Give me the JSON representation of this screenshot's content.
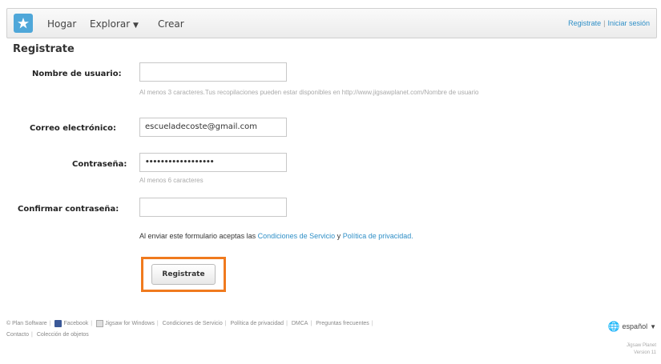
{
  "header": {
    "nav": {
      "home": "Hogar",
      "explore": "Explorar",
      "create": "Crear"
    },
    "register_link": "Registrate",
    "login_link": "Iniciar sesión"
  },
  "form": {
    "title": "Registrate",
    "username": {
      "label": "Nombre de usuario:",
      "value": "",
      "hint": "Al menos 3 caracteres.Tus recopilaciones pueden estar disponibles en http://www.jigsawplanet.com/Nombre de usuario"
    },
    "email": {
      "label": "Correo electrónico:",
      "value": "escueladecoste@gmail.com"
    },
    "password": {
      "label": "Contraseña:",
      "value": "••••••••••••••••••",
      "hint": "Al menos 6 caracteres"
    },
    "confirm": {
      "label": "Confirmar contraseña:",
      "value": ""
    },
    "legal_prefix": "Al enviar este formulario aceptas las",
    "terms_link": "Condiciones de Servicio",
    "legal_and": "y",
    "privacy_link": "Política de privacidad.",
    "submit_label": "Registrate"
  },
  "footer": {
    "links": [
      "© Plan Software",
      "Facebook",
      "Jigsaw for Windows",
      "Condiciones de Servicio",
      "Política de privacidad",
      "DMCA",
      "Preguntas frecuentes",
      "Contacto",
      "Colección de objetos"
    ],
    "language": "español",
    "version": [
      "Jigsaw Planet",
      "Version 11"
    ]
  },
  "colors": {
    "highlight": "#f07a1e",
    "link": "#2f8fc7",
    "logo": "#4fa7d9"
  }
}
